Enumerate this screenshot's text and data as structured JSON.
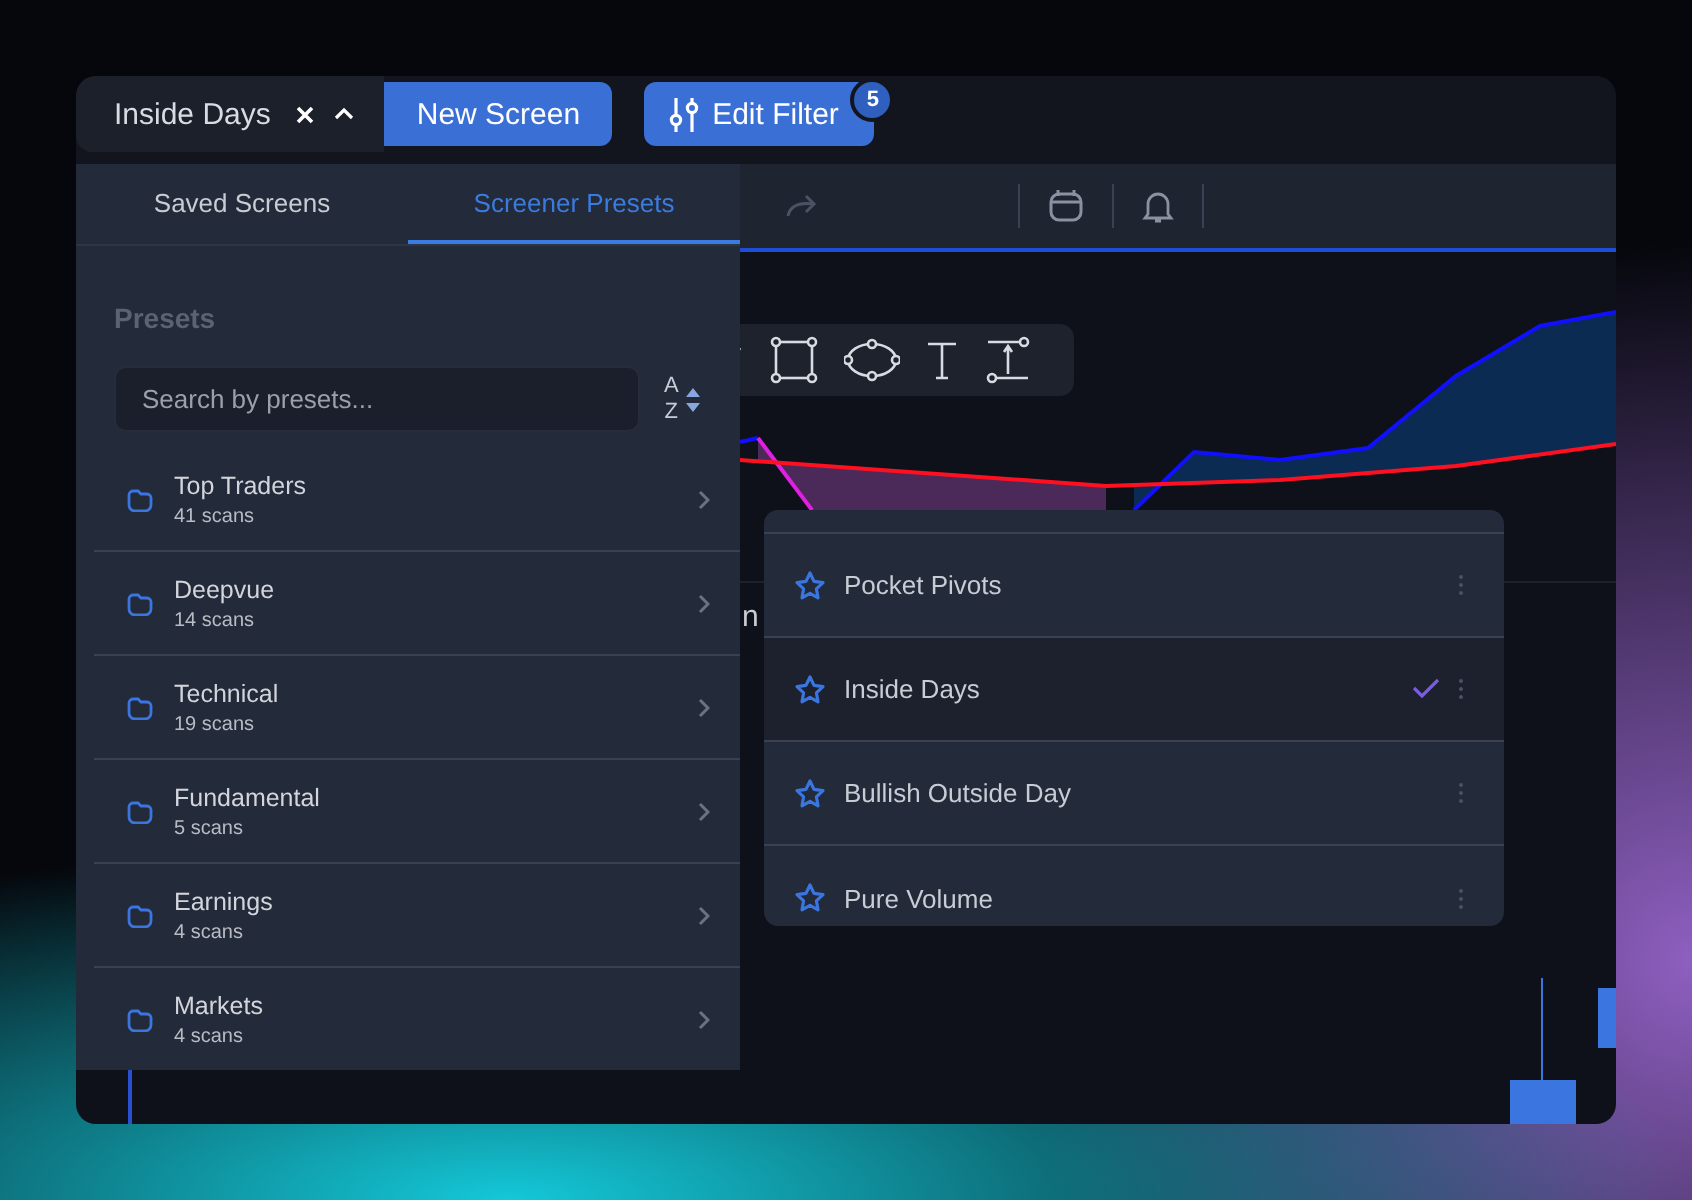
{
  "screen_tab": {
    "title": "Inside Days",
    "expanded": true
  },
  "new_screen_button": "New Screen",
  "edit_filter": {
    "label": "Edit Filter",
    "badge": "5"
  },
  "panel": {
    "tabs": [
      {
        "label": "Saved Screens",
        "selected": false
      },
      {
        "label": "Screener Presets",
        "selected": true
      }
    ],
    "heading": "Presets",
    "search": {
      "placeholder": "Search by presets..."
    },
    "sort": {
      "top": "A",
      "bottom": "Z"
    },
    "folders": [
      {
        "name": "Top Traders",
        "count": "41 scans"
      },
      {
        "name": "Deepvue",
        "count": "14 scans"
      },
      {
        "name": "Technical",
        "count": "19 scans"
      },
      {
        "name": "Fundamental",
        "count": "5 scans"
      },
      {
        "name": "Earnings",
        "count": "4 scans"
      },
      {
        "name": "Markets",
        "count": "4 scans"
      }
    ]
  },
  "chart_fragment": "n",
  "scan_menu": {
    "items": [
      {
        "name": "Pocket Pivots",
        "selected": false
      },
      {
        "name": "Inside Days",
        "selected": true
      },
      {
        "name": "Bullish Outside Day",
        "selected": false
      },
      {
        "name": "Pure Volume",
        "selected": false
      }
    ]
  }
}
